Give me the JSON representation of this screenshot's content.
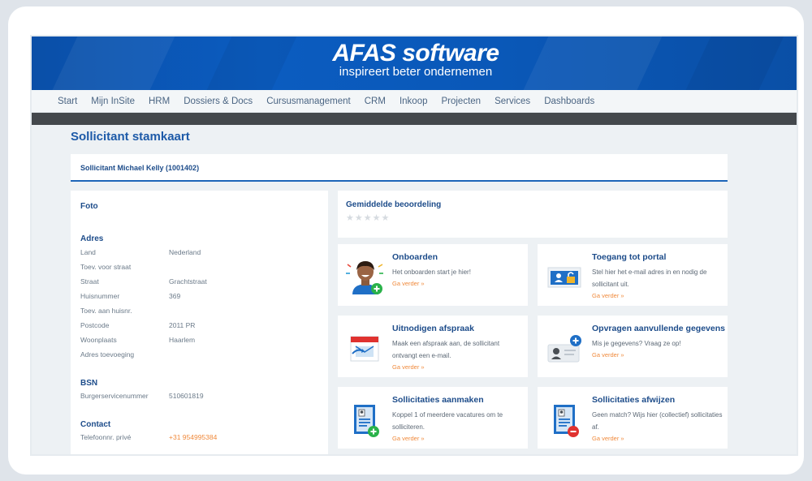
{
  "header": {
    "logo": "AFAS software",
    "tagline": "inspireert beter ondernemen"
  },
  "nav": {
    "items": [
      "Start",
      "Mijn InSite",
      "HRM",
      "Dossiers & Docs",
      "Cursusmanagement",
      "CRM",
      "Inkoop",
      "Projecten",
      "Services",
      "Dashboards"
    ]
  },
  "page": {
    "title": "Sollicitant stamkaart",
    "subtitle": "Sollicitant Michael Kelly (1001402)"
  },
  "left": {
    "foto_title": "Foto",
    "adres_title": "Adres",
    "adres_fields": [
      {
        "label": "Land",
        "value": "Nederland"
      },
      {
        "label": "Toev. voor straat",
        "value": ""
      },
      {
        "label": "Straat",
        "value": "Grachtstraat"
      },
      {
        "label": "Huisnummer",
        "value": "369"
      },
      {
        "label": "Toev. aan huisnr.",
        "value": ""
      },
      {
        "label": "Postcode",
        "value": "2011 PR"
      },
      {
        "label": "Woonplaats",
        "value": "Haarlem"
      },
      {
        "label": "Adres toevoeging",
        "value": ""
      }
    ],
    "bsn_title": "BSN",
    "bsn_field": {
      "label": "Burgerservicenummer",
      "value": "510601819"
    },
    "contact_title": "Contact",
    "contact_field": {
      "label": "Telefoonnr. privé",
      "value": "+31 954995384"
    }
  },
  "rating": {
    "title": "Gemiddelde beoordeling",
    "stars": "★★★★★",
    "value": 0
  },
  "actions": [
    {
      "title": "Onboarden",
      "desc": "Het onboarden start je hier!",
      "link": "Ga verder »",
      "icon": "onboarding-person-icon"
    },
    {
      "title": "Toegang tot portal",
      "desc": "Stel hier het e-mail adres in en nodig de sollicitant uit.",
      "link": "Ga verder »",
      "icon": "portal-access-icon"
    },
    {
      "title": "Uitnodigen afspraak",
      "desc": "Maak een afspraak aan, de sollicitant ontvangt een e-mail.",
      "link": "Ga verder »",
      "icon": "calendar-icon"
    },
    {
      "title": "Opvragen aanvullende gegevens",
      "desc": "Mis je gegevens? Vraag ze op!",
      "link": "Ga verder »",
      "icon": "request-data-icon"
    },
    {
      "title": "Sollicitaties aanmaken",
      "desc": "Koppel 1 of meerdere vacatures om te solliciteren.",
      "link": "Ga verder »",
      "icon": "add-application-icon"
    },
    {
      "title": "Sollicitaties afwijzen",
      "desc": "Geen match? Wijs hier (collectief) sollicitaties af.",
      "link": "Ga verder »",
      "icon": "reject-application-icon"
    }
  ],
  "colors": {
    "brand_blue": "#0b5cc0",
    "title_blue": "#1d5aa8",
    "link_orange": "#f08a3c",
    "green_badge": "#2ab24a",
    "red_badge": "#e0322f"
  }
}
